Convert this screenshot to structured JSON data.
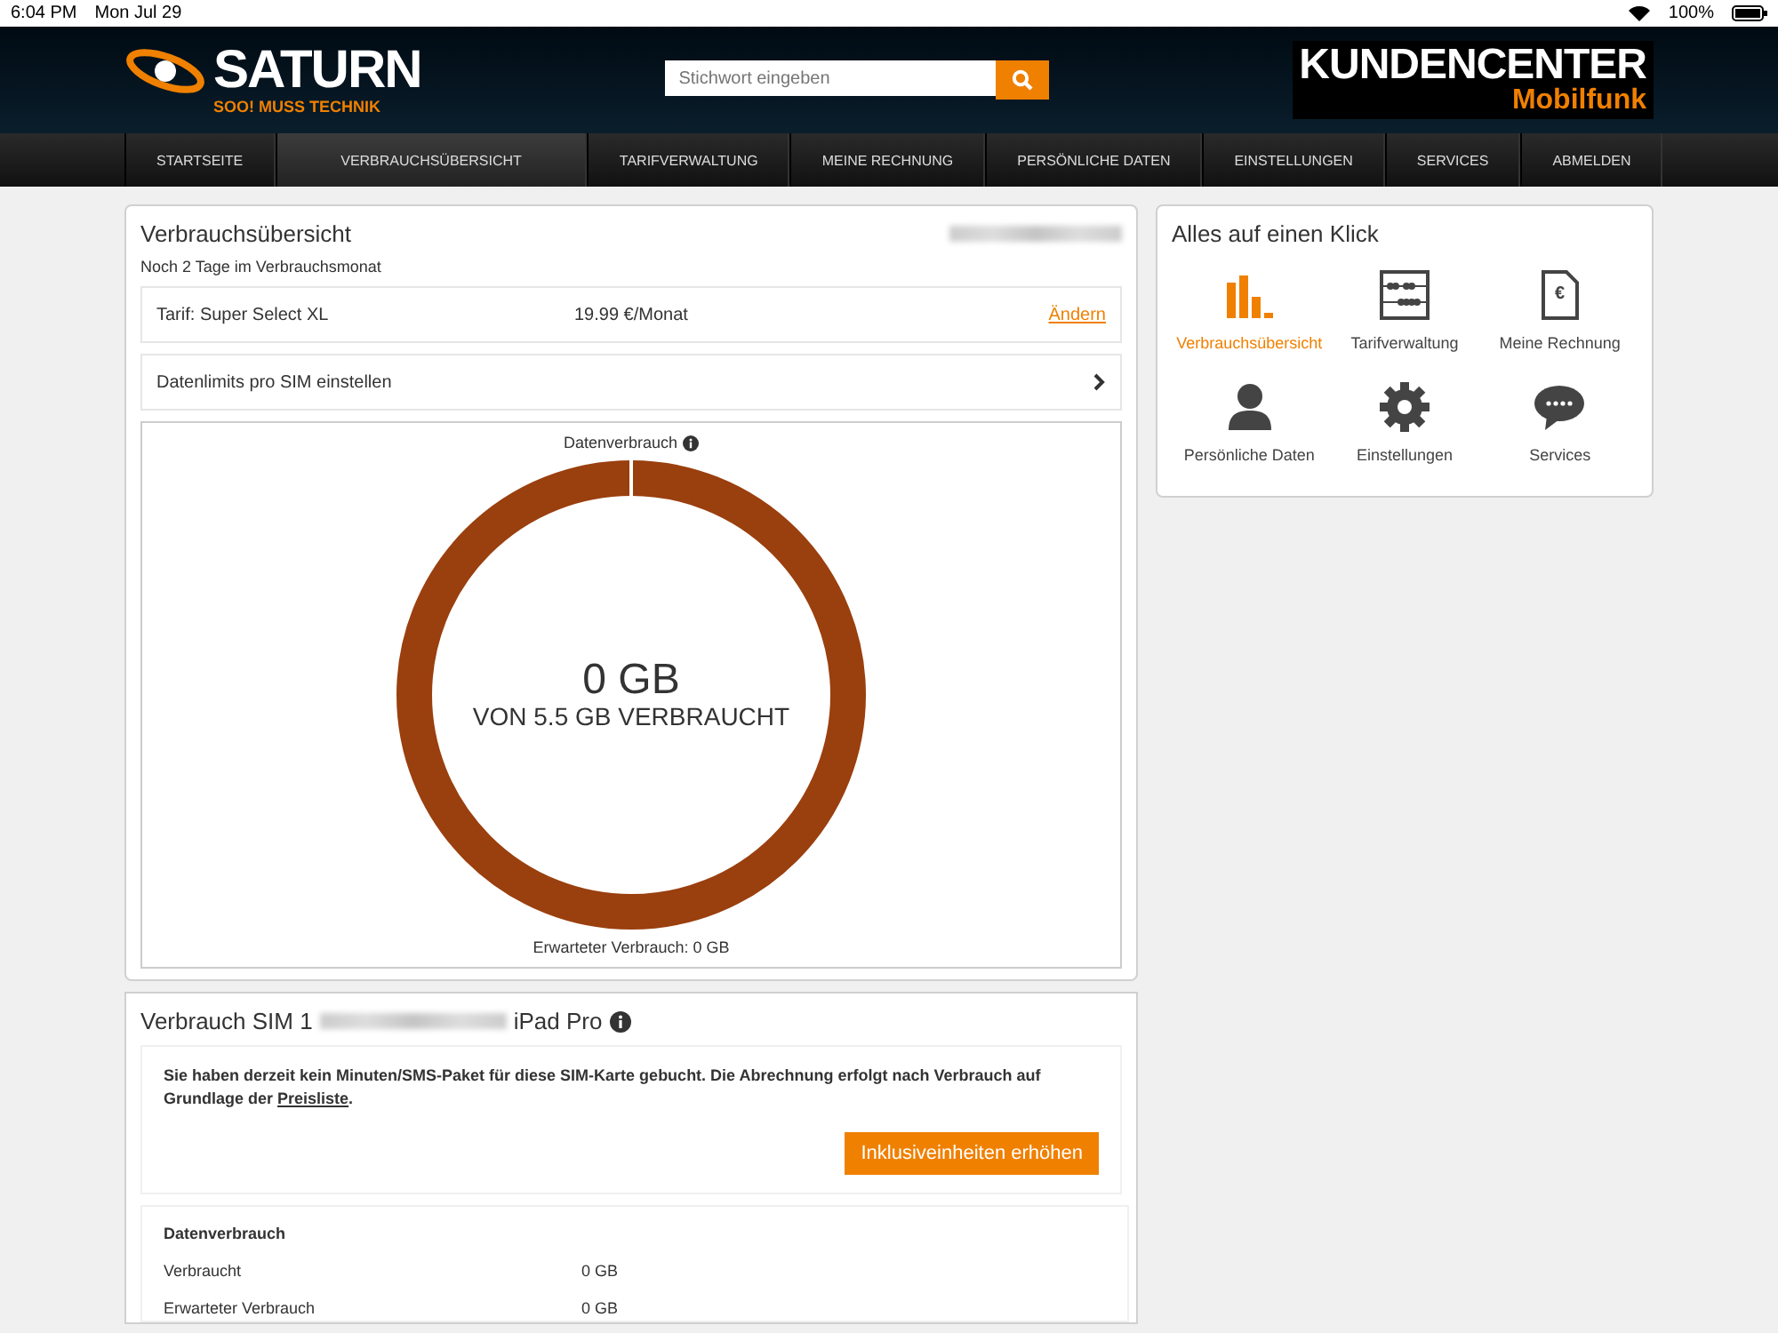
{
  "status_bar": {
    "time": "6:04 PM",
    "date": "Mon Jul 29",
    "battery": "100%"
  },
  "header": {
    "logo": "SATURN",
    "slogan": "SOO! MUSS TECHNIK",
    "search": {
      "placeholder": "Stichwort eingeben"
    },
    "portal_title": "KUNDENCENTER",
    "portal_subtitle": "Mobilfunk"
  },
  "nav": [
    {
      "label": "STARTSEITE",
      "selected": false
    },
    {
      "label": "VERBRAUCHSÜBERSICHT",
      "selected": true
    },
    {
      "label": "TARIFVERWALTUNG",
      "selected": false
    },
    {
      "label": "MEINE RECHNUNG",
      "selected": false
    },
    {
      "label": "PERSÖNLICHE DATEN",
      "selected": false
    },
    {
      "label": "EINSTELLUNGEN",
      "selected": false
    },
    {
      "label": "SERVICES",
      "selected": false
    },
    {
      "label": "ABMELDEN",
      "selected": false
    }
  ],
  "overview": {
    "title": "Verbrauchsübersicht",
    "subtitle": "Noch 2 Tage im Verbrauchsmonat",
    "tariff": {
      "name": "Tarif: Super Select XL",
      "price": "19.99 €/Monat",
      "link": "Ändern"
    },
    "limits_row": "Datenlimits pro SIM einstellen",
    "gauge": {
      "label": "Datenverbrauch",
      "value": "0 GB",
      "caption": "VON 5.5 GB VERBRAUCHT",
      "expected": "Erwarteter Verbrauch: 0 GB"
    }
  },
  "sim": {
    "title": "Verbrauch SIM 1",
    "device": "iPad Pro",
    "notice": "Sie haben derzeit kein Minuten/SMS-Paket für diese SIM-Karte gebucht. Die Abrechnung erfolgt nach Verbrauch auf Grundlage der ",
    "notice_link": "Preisliste",
    "notice_end": ".",
    "button": "Inklusiveinheiten erhöhen",
    "data_title": "Datenverbrauch",
    "rows": [
      {
        "label": "Verbraucht",
        "value": "0 GB"
      },
      {
        "label": "Erwarteter Verbrauch",
        "value": "0 GB"
      }
    ]
  },
  "quick": {
    "title": "Alles auf einen Klick",
    "items": [
      {
        "kind": "chart",
        "label": "Verbrauchsübersicht",
        "selected": true
      },
      {
        "kind": "abacus",
        "label": "Tarifverwaltung",
        "selected": false
      },
      {
        "kind": "invoice",
        "label": "Meine Rechnung",
        "symbol": "€",
        "selected": false
      },
      {
        "kind": "person",
        "label": "Persönliche Daten",
        "selected": false
      },
      {
        "kind": "gear",
        "label": "Einstellungen",
        "selected": false
      },
      {
        "kind": "chat",
        "label": "Services",
        "selected": false
      }
    ]
  }
}
